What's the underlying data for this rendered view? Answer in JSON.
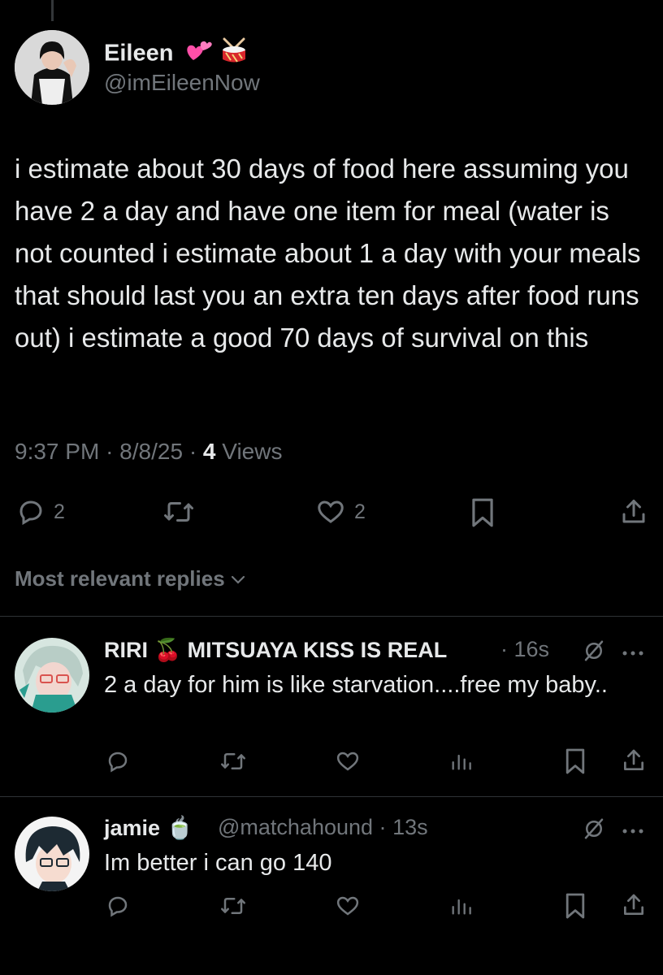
{
  "tweet": {
    "author_name": "Eileen",
    "author_emojis": [
      "💕",
      "🥁"
    ],
    "handle": "@imEileenNow",
    "text": "i estimate about 30 days of food here assuming you have 2 a day and have one item for meal (water is not counted i estimate about 1 a day with your meals that should last you an extra ten days after food runs out) i estimate a good 70 days of survival on this",
    "time": "9:37 PM",
    "date": "8/8/25",
    "views_count": "4",
    "views_label": "Views",
    "reply_count": "2",
    "like_count": "2"
  },
  "sort": {
    "label": "Most relevant replies"
  },
  "replies": [
    {
      "name": "RIRI 🍒 MITSUAYA KISS IS REAL",
      "handle": "",
      "time": "16s",
      "text": "2 a day for him is like starvation....free my baby.."
    },
    {
      "name": "jamie 🍵",
      "handle": "@matchahound",
      "time": "13s",
      "text": "Im better i can go 140"
    }
  ],
  "colors": {
    "background": "#000000",
    "text": "#e7e9ea",
    "muted": "#71767b",
    "divider": "#2f3336",
    "pink_heart": "#ff4fa8"
  }
}
